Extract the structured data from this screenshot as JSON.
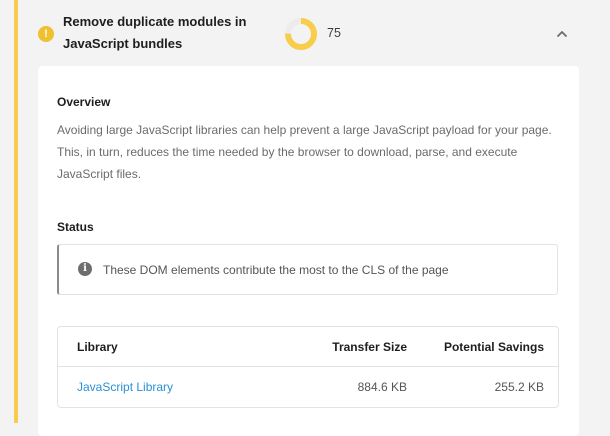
{
  "audit": {
    "title": "Remove duplicate modules in JavaScript bundles",
    "score": "75",
    "score_fraction": 0.75,
    "accent_color": "#f8cd4b",
    "warning_icon": "exclamation-icon",
    "toggle_icon": "chevron-up-icon"
  },
  "overview": {
    "heading": "Overview",
    "text": "Avoiding large JavaScript libraries can help prevent a large JavaScript payload for your page. This, in turn, reduces the time needed by the browser to download, parse, and execute JavaScript files."
  },
  "status": {
    "heading": "Status",
    "icon": "info-icon",
    "message": "These DOM elements contribute the most to the CLS of the page"
  },
  "table": {
    "headers": [
      "Library",
      "Transfer Size",
      "Potential Savings"
    ],
    "rows": [
      [
        "JavaScript Library",
        "884.6 KB",
        "255.2 KB"
      ]
    ]
  }
}
